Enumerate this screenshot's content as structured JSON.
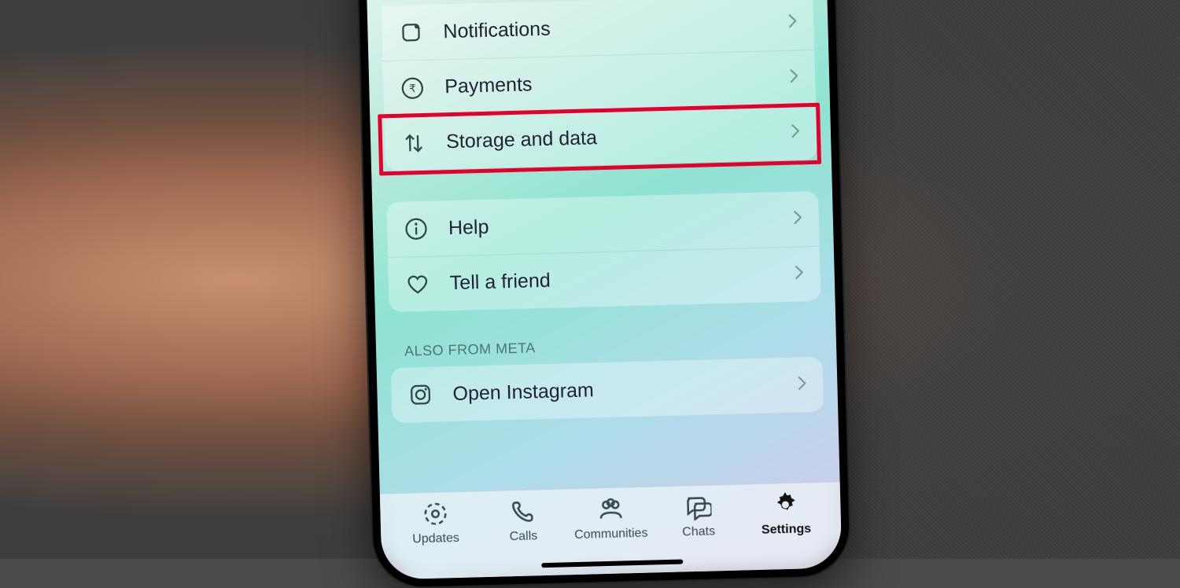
{
  "settings": {
    "group1": {
      "notifications": "Notifications",
      "payments": "Payments",
      "storage": "Storage and data"
    },
    "group2": {
      "help": "Help",
      "tell": "Tell a friend"
    },
    "meta_header": "ALSO FROM META",
    "group3": {
      "instagram": "Open Instagram"
    }
  },
  "tabs": {
    "updates": "Updates",
    "calls": "Calls",
    "communities": "Communities",
    "chats": "Chats",
    "settings": "Settings"
  }
}
